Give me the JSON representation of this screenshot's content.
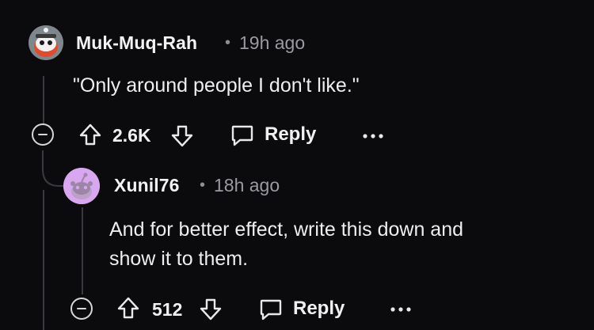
{
  "comments": [
    {
      "username": "Muk-Muq-Rah",
      "separator": "•",
      "time": "19h ago",
      "body_lines": [
        "\"Only around people I don't like.\""
      ],
      "score": "2.6K",
      "reply_label": "Reply",
      "more_label": "•••"
    },
    {
      "username": "Xunil76",
      "separator": "•",
      "time": "18h ago",
      "body_lines": [
        "And for better effect, write this down and",
        "show it to them."
      ],
      "score": "512",
      "reply_label": "Reply",
      "more_label": "•••"
    }
  ],
  "colors": {
    "background": "#0b0b0d",
    "text": "#eeeeef",
    "muted": "#9a9aa0",
    "thread_line": "#3a3a3e",
    "avatar2_bg": "#d9a7f0"
  },
  "icons": [
    "snoo-avatar-icon",
    "collapse-icon",
    "upvote-arrow-icon",
    "downvote-arrow-icon",
    "comment-bubble-icon",
    "more-options-icon"
  ]
}
